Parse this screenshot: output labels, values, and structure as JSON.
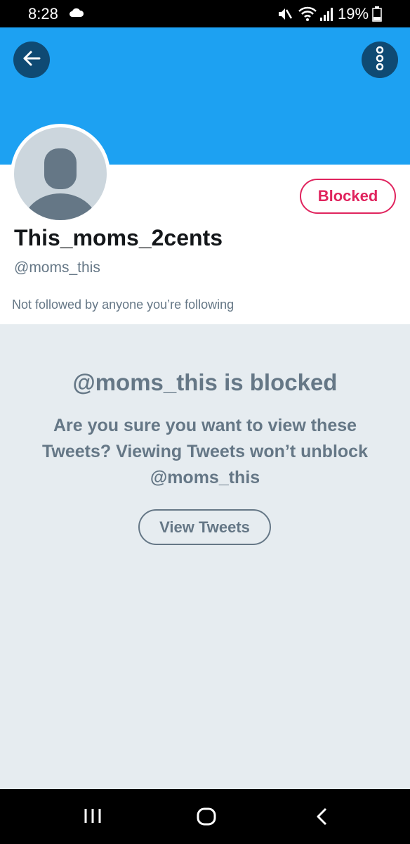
{
  "status_bar": {
    "time": "8:28",
    "battery": "19%"
  },
  "header": {
    "back_icon": "arrow-left-icon",
    "more_icon": "vertical-dots-icon",
    "banner_color": "#1da1f2"
  },
  "profile": {
    "display_name": "This_moms_2cents",
    "handle": "@moms_this",
    "blocked_label": "Blocked",
    "followed_note": "Not followed by anyone you’re following"
  },
  "blocked_notice": {
    "title": "@moms_this is blocked",
    "description": "Are you sure you want to view these Tweets? Viewing Tweets won’t unblock @moms_this",
    "button_label": "View Tweets"
  },
  "colors": {
    "accent": "#1da1f2",
    "blocked": "#e0245e",
    "muted_text": "#657786",
    "background": "#e6ecf0"
  }
}
